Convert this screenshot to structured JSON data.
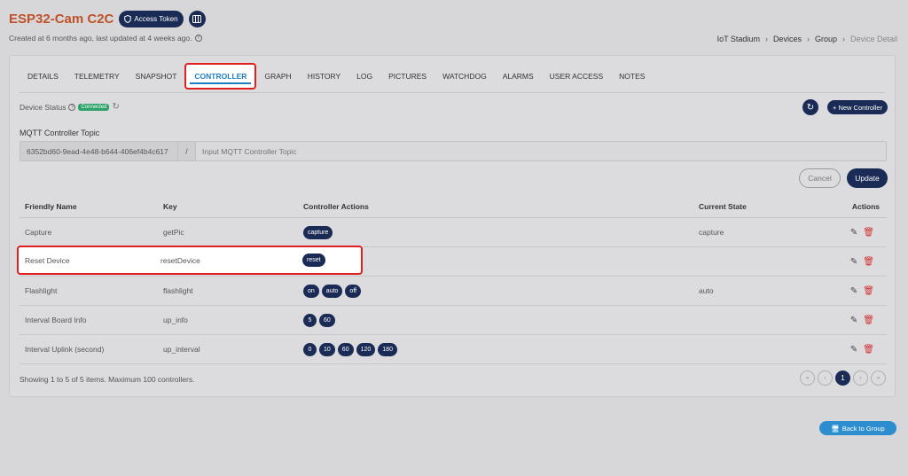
{
  "header": {
    "title": "ESP32-Cam C2C",
    "access_token_label": "Access Token",
    "subtitle": "Created at 6 months ago, last updated at 4 weeks ago.",
    "icons": [
      "shield-icon",
      "columns-icon",
      "info-icon"
    ]
  },
  "breadcrumb": [
    "IoT Stadium",
    "Devices",
    "Group",
    "Device Detail"
  ],
  "tabs": [
    "DETAILS",
    "TELEMETRY",
    "SNAPSHOT",
    "CONTROLLER",
    "GRAPH",
    "HISTORY",
    "LOG",
    "PICTURES",
    "WATCHDOG",
    "ALARMS",
    "USER ACCESS",
    "NOTES"
  ],
  "active_tab": "CONTROLLER",
  "device_status": {
    "label": "Device Status",
    "badge": "Connected"
  },
  "new_controller_label": "+ New Controller",
  "mqtt": {
    "label": "MQTT Controller Topic",
    "prefix": "6352bd60-9ead-4e48-b644-406ef4b4c617",
    "slash": "/",
    "placeholder": "Input MQTT Controller Topic"
  },
  "buttons": {
    "cancel": "Cancel",
    "update": "Update",
    "back": "Back to Group"
  },
  "table": {
    "headers": [
      "Friendly Name",
      "Key",
      "Controller Actions",
      "Current State",
      "Actions"
    ],
    "rows": [
      {
        "name": "Capture",
        "key": "getPic",
        "actions": [
          "capture"
        ],
        "state": "capture"
      },
      {
        "name": "Reset Device",
        "key": "resetDevice",
        "actions": [
          "reset"
        ],
        "state": ""
      },
      {
        "name": "Flashlight",
        "key": "flashlight",
        "actions": [
          "on",
          "auto",
          "off"
        ],
        "state": "auto"
      },
      {
        "name": "Interval Board Info",
        "key": "up_info",
        "actions": [
          "5",
          "60"
        ],
        "state": ""
      },
      {
        "name": "Interval Uplink (second)",
        "key": "up_interval",
        "actions": [
          "0",
          "10",
          "60",
          "120",
          "180"
        ],
        "state": ""
      }
    ]
  },
  "footer": {
    "summary": "Showing 1 to 5 of 5 items. Maximum 100 controllers."
  },
  "pagination": {
    "first": "«",
    "prev": "‹",
    "current": "1",
    "next": "›",
    "last": "»"
  },
  "colors": {
    "primary": "#1a2b55",
    "accent": "#1e7fc0",
    "title": "#c0522b",
    "highlight": "#e02020",
    "success": "#2ea26a"
  }
}
